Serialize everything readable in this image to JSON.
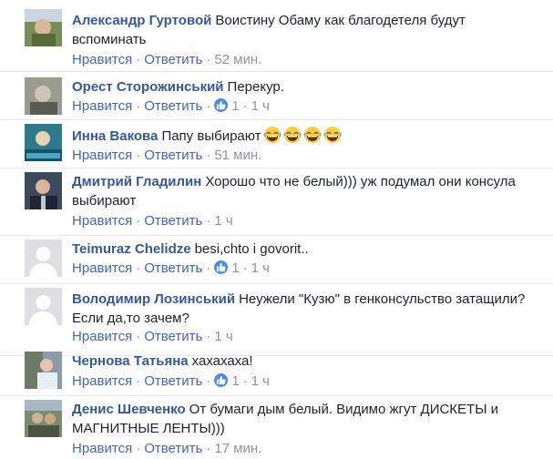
{
  "actions": {
    "like": "Нравится",
    "reply": "Ответить",
    "separator": "·"
  },
  "comments": [
    {
      "author": "Александр Гуртовой",
      "text": "Воистину Обаму как благодетеля будут вспоминать",
      "likes": "",
      "time": "52 мин."
    },
    {
      "author": "Орест Сторожинський",
      "text": "Перекур.",
      "likes": "1",
      "time": "1 ч"
    },
    {
      "author": "Инна Вакова",
      "text": "Папу выбирают",
      "likes": "",
      "time": "51 мин."
    },
    {
      "author": "Дмитрий Гладилин",
      "text": "Хорошо что не белый))) уж подумал они консула выбирают",
      "likes": "",
      "time": "1 ч"
    },
    {
      "author": "Teimuraz Chelidze",
      "text": "besi,chto i govorit..",
      "likes": "1",
      "time": "1 ч"
    },
    {
      "author": "Володимир Лозинський",
      "text": "Неужели \"Кузю\" в генконсульство затащили?Если да,то зачем?",
      "likes": "",
      "time": "1 ч"
    },
    {
      "author": "Чернова Татьяна",
      "text": "хахахаха!",
      "likes": "1",
      "time": "1 ч"
    },
    {
      "author": "Денис Шевченко",
      "text": "От бумаги дым белый. Видимо жгут ДИСКЕТЫ и МАГНИТНЫЕ ЛЕНТЫ)))",
      "likes": "",
      "time": "17 мин."
    }
  ],
  "colors": {
    "author": "#365899",
    "link": "#4267b2",
    "meta": "#90949c",
    "like_badge": "#4a8af4"
  }
}
